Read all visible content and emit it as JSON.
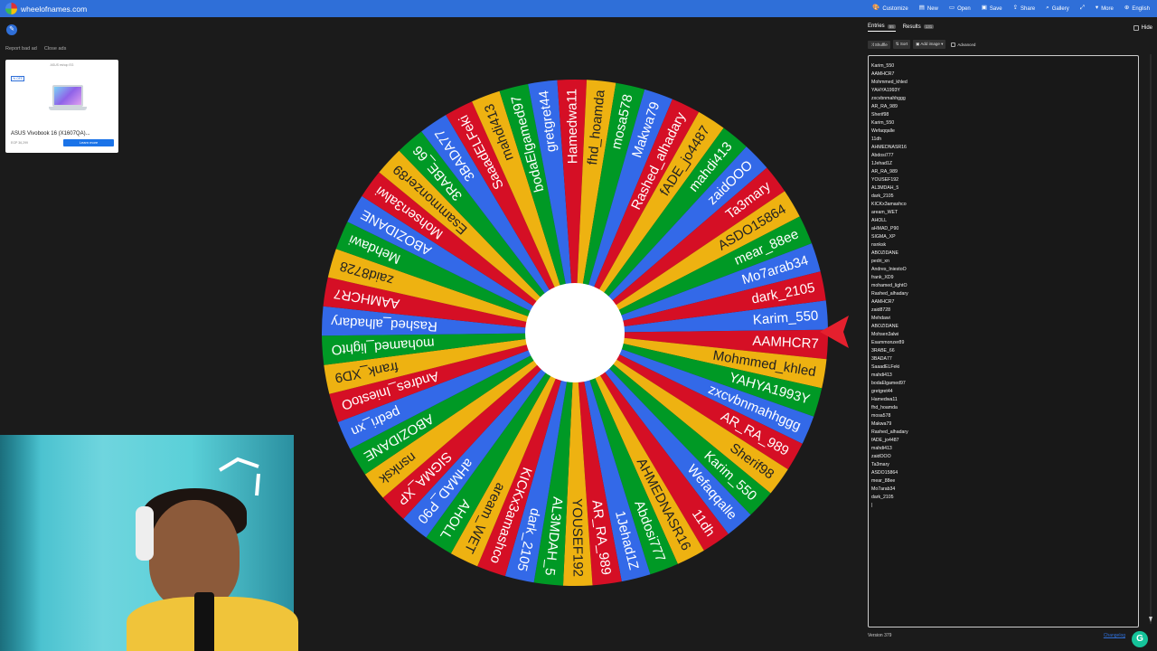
{
  "header": {
    "site_name": "wheelofnames.com",
    "menu": [
      {
        "label": "Customize",
        "icon": "🎨",
        "name": "customize"
      },
      {
        "label": "New",
        "icon": "▤",
        "name": "new"
      },
      {
        "label": "Open",
        "icon": "▭",
        "name": "open"
      },
      {
        "label": "Save",
        "icon": "▣",
        "name": "save"
      },
      {
        "label": "Share",
        "icon": "⇪",
        "name": "share"
      },
      {
        "label": "Gallery",
        "icon": "⌕",
        "name": "gallery"
      },
      {
        "label": "",
        "icon": "⤢",
        "name": "fullscreen"
      },
      {
        "label": "More",
        "icon": "▾",
        "name": "more"
      },
      {
        "label": "English",
        "icon": "⊕",
        "name": "language"
      }
    ],
    "colors": {
      "bar": "#2f6fd8"
    }
  },
  "ad": {
    "report": "Report bad ad",
    "close": "Close ads",
    "sponsor": "ASUS eshop EG",
    "badge": "% OFF",
    "title": "ASUS Vivobook 16 (X1607QA)...",
    "price": "EGP 36,299",
    "cta": "Learn more"
  },
  "wheel": {
    "colors": [
      "#3369e8",
      "#d50f25",
      "#eeb211",
      "#009925"
    ],
    "entries": [
      "Karim_550",
      "AAMHCR7",
      "Mohmmed_khled",
      "YAHYA1993Y",
      "zxcvbnmahhggg",
      "AR_RA_989",
      "Sherif98",
      "Karim_550",
      "Wefaqqalle",
      "11dh",
      "AHMEDNASR16",
      "Abdosi777",
      "1Jehad1Z",
      "AR_RA_989",
      "YOUSEF192",
      "AL3MDAH_5",
      "dark_2105",
      "KICKx3amashco",
      "aream_WET",
      "AHOLL",
      "aHMAD_P90",
      "SIGMA_XP",
      "nsnksk",
      "ABOZIDANE",
      "pedri_xn",
      "Andres_IniestoO",
      "frank_XD9",
      "mohamed_lightO",
      "Rashed_alhadary",
      "AAMHCR7",
      "zaid8728",
      "Mehdawi",
      "ABOZIDANE",
      "Mohsen3alwi",
      "Esammonzer89",
      "3RABE_66",
      "3BADA77",
      "SaaadELFeki",
      "mahdi413",
      "bodaElgamed97",
      "gretgret44",
      "Hamedwa11",
      "fhd_hoamda",
      "mosa578",
      "Makwa79",
      "Rashed_alhadary",
      "fADE_jo4487",
      "mahdi413",
      "zaidOOO",
      "Ta3mary",
      "ASDO15864",
      "mear_88ee",
      "Mo7arab34",
      "dark_2105"
    ],
    "selected": "Mohsen3alwi"
  },
  "panel": {
    "tabs": [
      {
        "label": "Entries",
        "count": "55"
      },
      {
        "label": "Results",
        "count": "131"
      }
    ],
    "hide_label": "Hide",
    "toolbar": [
      "Shuffle",
      "Sort",
      "Add image"
    ],
    "advanced": "Advanced",
    "entries": [
      "Karim_550",
      "AAMHCR7",
      "Mohmmed_khled",
      "YAHYA1993Y",
      "zxcvbnmahhggg",
      "AR_RA_989",
      "Sherif98",
      "Karim_550",
      "Wefaqqalle",
      "11dh",
      "AHMEDNASR16",
      "Abdosi777",
      "1Jehad1Z",
      "AR_RA_989",
      "YOUSEF192",
      "AL3MDAH_5",
      "dark_2105",
      "KICKx3amashco",
      "aream_WET",
      "AHOLL",
      "aHMAD_P90",
      "SIGMA_XP",
      "nsnksk",
      "ABOZIDANE",
      "pedri_xn",
      "Andres_IniestoO",
      "frank_XD9",
      "mohamed_lightO",
      "Rashed_alhadary",
      "AAMHCR7",
      "zaid8728",
      "Mehdawi",
      "ABOZIDANE",
      "Mohsen3alwi",
      "Esammonzer89",
      "3RABE_66",
      "3BADA77",
      "SaaadELFeki",
      "mahdi413",
      "bodaElgamed97",
      "gretgret44",
      "Hamedwa11",
      "fhd_hoamda",
      "mosa578",
      "Makwa79",
      "Rashed_alhadary",
      "fADE_jo4487",
      "mahdi413",
      "zaidOOO",
      "Ta3mary",
      "ASDO15864",
      "mear_88ee",
      "Mo7arab34",
      "dark_2105",
      "|"
    ],
    "version": "Version 379",
    "changelog": "Changelog"
  }
}
